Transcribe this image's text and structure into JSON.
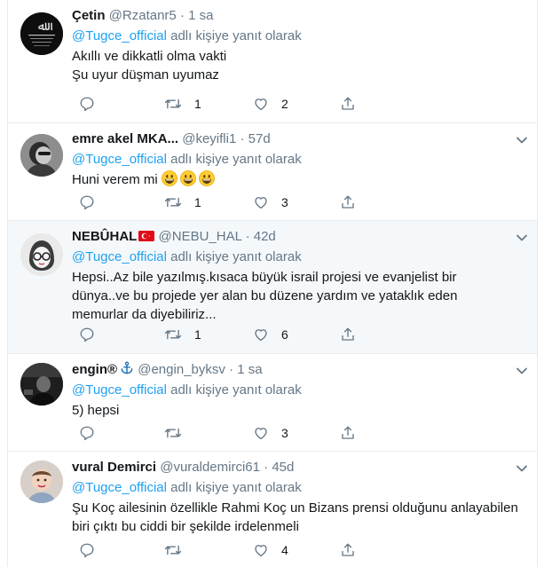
{
  "tweets": [
    {
      "name": "Çetin",
      "handle": "@Rzatanr5",
      "sep": "·",
      "time": "1 sa",
      "reply_to": "@Tugce_official",
      "reply_suffix": " adlı kişiye yanıt olarak",
      "lines": [
        "Akıllı ve dikkatli olma vakti",
        "Şu uyur düşman uyumaz"
      ],
      "retweets": "1",
      "likes": "2",
      "avatar": "dark-logo"
    },
    {
      "name": "emre akel MKA...",
      "handle": "@keyifli1",
      "sep": "·",
      "time": "57d",
      "reply_to": "@Tugce_official",
      "reply_suffix": " adlı kişiye yanıt olarak",
      "lines": [
        "Huni verem mi "
      ],
      "emoji": [
        "grinning-face-emoji",
        "grinning-face-emoji",
        "grinning-face-emoji"
      ],
      "retweets": "1",
      "likes": "3",
      "avatar": "photo-bw"
    },
    {
      "name": "NEBÛHAL",
      "flag": "turkey-flag-emoji",
      "handle": "@NEBU_HAL",
      "sep": "·",
      "time": "42d",
      "reply_to": "@Tugce_official",
      "reply_suffix": " adlı kişiye yanıt olarak",
      "lines": [
        "Hepsi..Az bile yazılmış.kısaca büyük israil projesi ve evanjelist bir",
        "dünya..ve bu projede yer alan bu  düzene yardım ve yataklık eden",
        "memurlar da diyebiliriz..."
      ],
      "retweets": "1",
      "likes": "6",
      "avatar": "sketch-glasses",
      "highlighted": true
    },
    {
      "name": "engin®",
      "anchor": "anchor-emoji",
      "handle": "@engin_byksv",
      "sep": "·",
      "time": "1 sa",
      "reply_to": "@Tugce_official",
      "reply_suffix": " adlı kişiye yanıt olarak",
      "lines": [
        "5) hepsi"
      ],
      "retweets": "",
      "likes": "3",
      "avatar": "photo-dark"
    },
    {
      "name": "vural Demirci",
      "handle": "@vuraldemirci61",
      "sep": "·",
      "time": "45d",
      "reply_to": "@Tugce_official",
      "reply_suffix": " adlı kişiye yanıt olarak",
      "lines": [
        "Şu Koç ailesinin özellikle Rahmi Koç un Bizans prensi olduğunu anlayabilen",
        "biri çıktı bu ciddi bir şekilde irdelenmeli"
      ],
      "retweets": "",
      "likes": "4",
      "avatar": "photo-child"
    }
  ],
  "colors": {
    "link": "#1da1f2",
    "muted": "#657786",
    "border": "#e6ecf0",
    "highlight_bg": "#f5f8fa"
  }
}
